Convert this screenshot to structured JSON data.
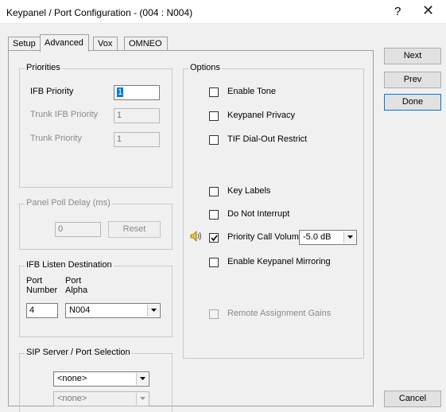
{
  "window": {
    "title": "Keypanel / Port Configuration - (004 : N004)",
    "help_glyph": "?",
    "close_glyph": "✕"
  },
  "tabs": [
    {
      "label": "Setup"
    },
    {
      "label": "Advanced"
    },
    {
      "label": "Vox"
    },
    {
      "label": "OMNEO"
    }
  ],
  "priorities": {
    "legend": "Priorities",
    "ifb_priority_label": "IFB Priority",
    "ifb_priority_value": "1",
    "trunk_ifb_priority_label": "Trunk IFB Priority",
    "trunk_ifb_priority_value": "1",
    "trunk_priority_label": "Trunk Priority",
    "trunk_priority_value": "1"
  },
  "panel_poll": {
    "legend": "Panel Poll Delay (ms)",
    "value": "0",
    "reset_label": "Reset"
  },
  "ifb_listen": {
    "legend": "IFB Listen Destination",
    "port_number_header_1": "Port",
    "port_number_header_2": "Number",
    "port_alpha_header_1": "Port",
    "port_alpha_header_2": "Alpha",
    "port_number_value": "4",
    "port_alpha_value": "N004"
  },
  "sip": {
    "legend": "SIP Server / Port Selection",
    "server_value": "<none>",
    "port_value": "<none>"
  },
  "options": {
    "legend": "Options",
    "enable_tone": {
      "label": "Enable Tone",
      "checked": false
    },
    "keypanel_privacy": {
      "label": "Keypanel Privacy",
      "checked": false
    },
    "tif_dialout": {
      "label": "TIF Dial-Out Restrict",
      "checked": false
    },
    "key_labels": {
      "label": "Key Labels",
      "checked": false
    },
    "do_not_interrupt": {
      "label": "Do Not Interrupt",
      "checked": false
    },
    "priority_call_volume": {
      "label": "Priority Call Volume",
      "checked": true,
      "value": "-5.0 dB"
    },
    "enable_mirroring": {
      "label": "Enable Keypanel Mirroring",
      "checked": false
    },
    "remote_gains": {
      "label": "Remote Assignment Gains",
      "checked": false
    }
  },
  "side_buttons": {
    "next": "Next",
    "prev": "Prev",
    "done": "Done",
    "cancel": "Cancel"
  },
  "icons": {
    "speaker": "speaker-icon",
    "dropdown": "chevron-down-icon",
    "check": "checkmark-icon"
  }
}
